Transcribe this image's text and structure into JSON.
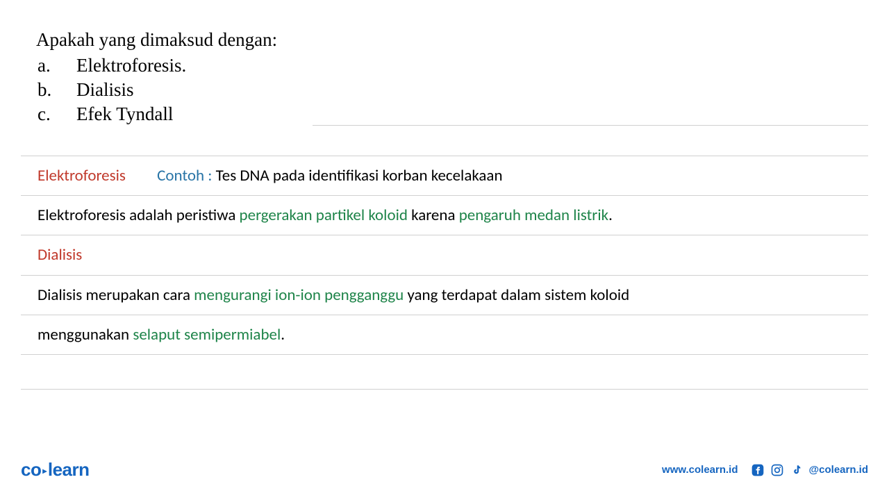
{
  "question": {
    "title": "Apakah yang dimaksud dengan:",
    "items": [
      {
        "letter": "a.",
        "text": "Elektroforesis."
      },
      {
        "letter": "b.",
        "text": "Dialisis"
      },
      {
        "letter": "c.",
        "text": "Efek Tyndall"
      }
    ]
  },
  "answers": {
    "row1": {
      "heading": "Elektroforesis",
      "example_label": "Contoh :",
      "example_text": " Tes DNA pada identifikasi korban kecelakaan"
    },
    "row2": {
      "prefix": "Elektroforesis adalah peristiwa ",
      "green1": "pergerakan partikel koloid",
      "mid": " karena ",
      "green2": "pengaruh medan listrik",
      "suffix": "."
    },
    "row3": {
      "heading": "Dialisis"
    },
    "row4": {
      "prefix": "Dialisis merupakan cara ",
      "green1": "mengurangi ion-ion pengganggu",
      "suffix": " yang terdapat dalam sistem koloid"
    },
    "row5": {
      "prefix": "menggunakan ",
      "green1": "selaput semipermiabel",
      "suffix": "."
    }
  },
  "footer": {
    "logo_co": "co",
    "logo_learn": "learn",
    "url": "www.colearn.id",
    "handle": "@colearn.id"
  }
}
